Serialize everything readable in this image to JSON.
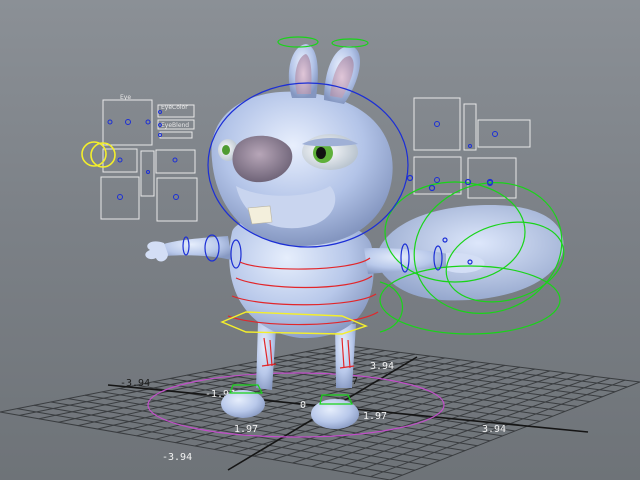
{
  "viewport": {
    "background_top": "#8b9096",
    "background_bottom": "#6e7378",
    "grid_color": "#3a3d40",
    "grid_axis_color": "#151515"
  },
  "ui_panel": {
    "eye_label": "Eye",
    "eyecolor_label": "EyeColor",
    "eyeblend_label": "EyeBlend"
  },
  "grid_labels": {
    "left_far": "-3.94",
    "left_mid": "-1.97",
    "origin": "0",
    "right_near": "1.97",
    "right_far": "3.94",
    "back_near": "1.97",
    "back_far": "3.94",
    "front_near": "1.97",
    "front_far": "-3.94"
  },
  "control_colors": {
    "blue": "#1c2fd6",
    "green": "#19d419",
    "red": "#e2262a",
    "yellow": "#f4ef2b",
    "magenta": "#c14fc9",
    "body": "#b8c8ea"
  },
  "icons": [
    "eye-selector-icon"
  ]
}
